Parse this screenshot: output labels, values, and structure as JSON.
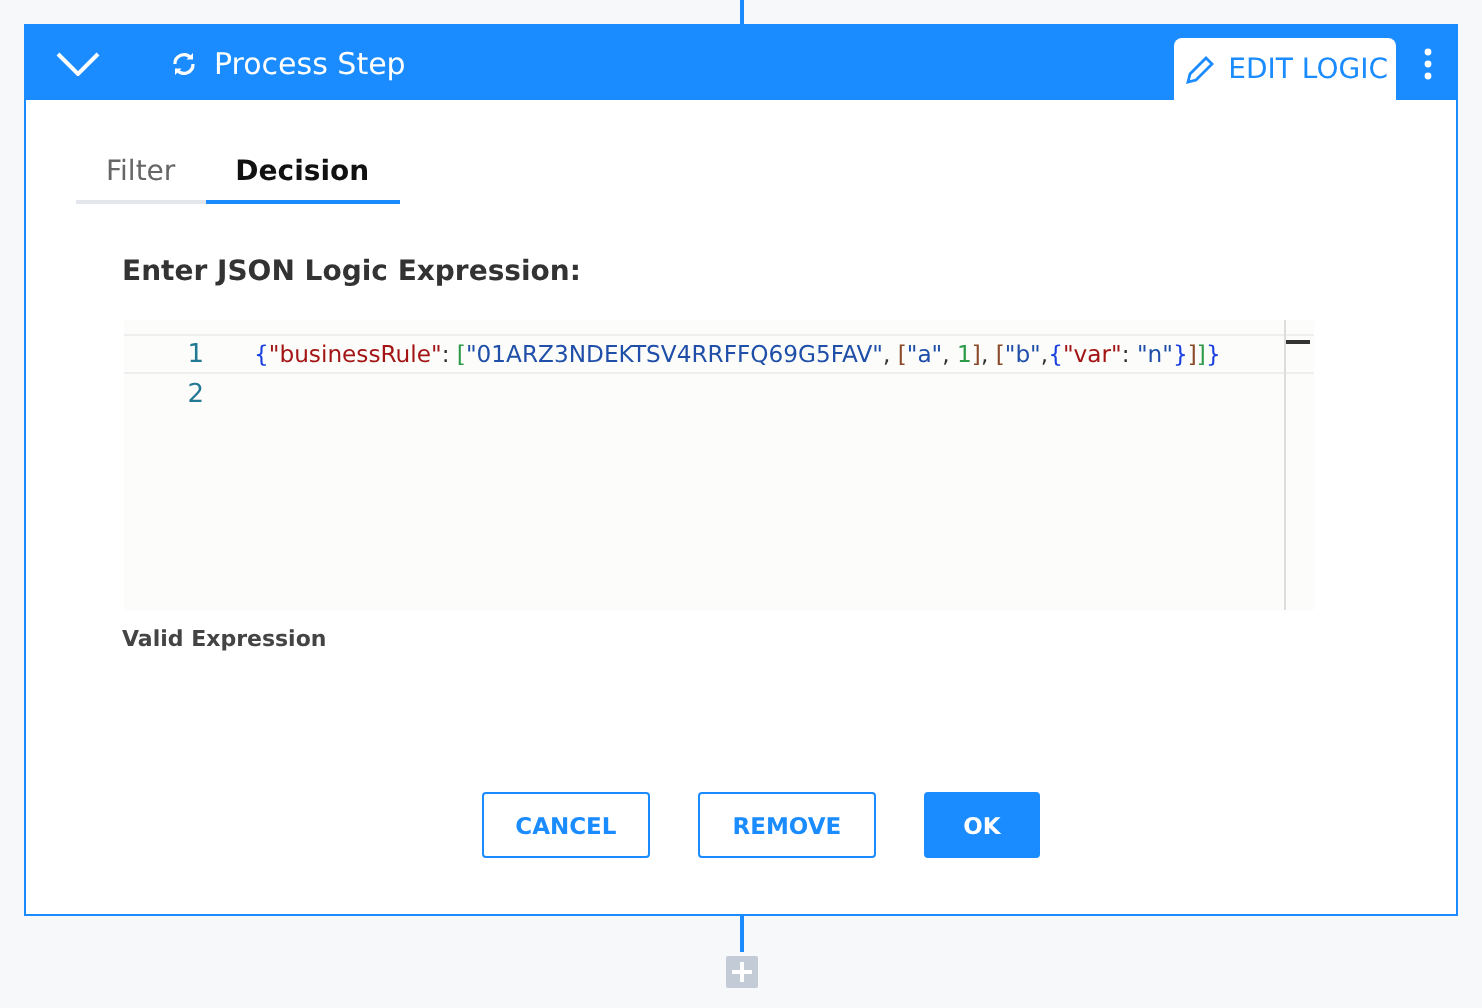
{
  "header": {
    "title": "Process Step",
    "edit_button": "EDIT LOGIC"
  },
  "tabs": [
    {
      "label": "Filter",
      "selected": false
    },
    {
      "label": "Decision",
      "selected": true
    }
  ],
  "editor": {
    "label": "Enter JSON Logic Expression:",
    "lines": [
      {
        "number": "1",
        "tokens": [
          {
            "text": "{",
            "kind": "brace"
          },
          {
            "text": "\"businessRule\"",
            "kind": "key"
          },
          {
            "text": ": ",
            "kind": "punct"
          },
          {
            "text": "[",
            "kind": "bracket1"
          },
          {
            "text": "\"01ARZ3NDEKTSV4RRFFQ69G5FAV\"",
            "kind": "string"
          },
          {
            "text": ", ",
            "kind": "punct"
          },
          {
            "text": "[",
            "kind": "bracket2"
          },
          {
            "text": "\"a\"",
            "kind": "string"
          },
          {
            "text": ", ",
            "kind": "punct"
          },
          {
            "text": "1",
            "kind": "number"
          },
          {
            "text": "]",
            "kind": "bracket2"
          },
          {
            "text": ", ",
            "kind": "punct"
          },
          {
            "text": "[",
            "kind": "bracket2"
          },
          {
            "text": "\"b\"",
            "kind": "string"
          },
          {
            "text": ",",
            "kind": "punct"
          },
          {
            "text": "{",
            "kind": "brace"
          },
          {
            "text": "\"var\"",
            "kind": "key"
          },
          {
            "text": ": ",
            "kind": "punct"
          },
          {
            "text": "\"n\"",
            "kind": "string"
          },
          {
            "text": "}",
            "kind": "brace"
          },
          {
            "text": "]",
            "kind": "bracket2"
          },
          {
            "text": "]",
            "kind": "bracket1"
          },
          {
            "text": "}",
            "kind": "brace"
          }
        ]
      },
      {
        "number": "2"
      }
    ],
    "status": "Valid Expression"
  },
  "buttons": [
    {
      "label": "CANCEL",
      "kind": "outline"
    },
    {
      "label": "REMOVE",
      "kind": "outline"
    },
    {
      "label": "OK",
      "kind": "primary"
    }
  ]
}
